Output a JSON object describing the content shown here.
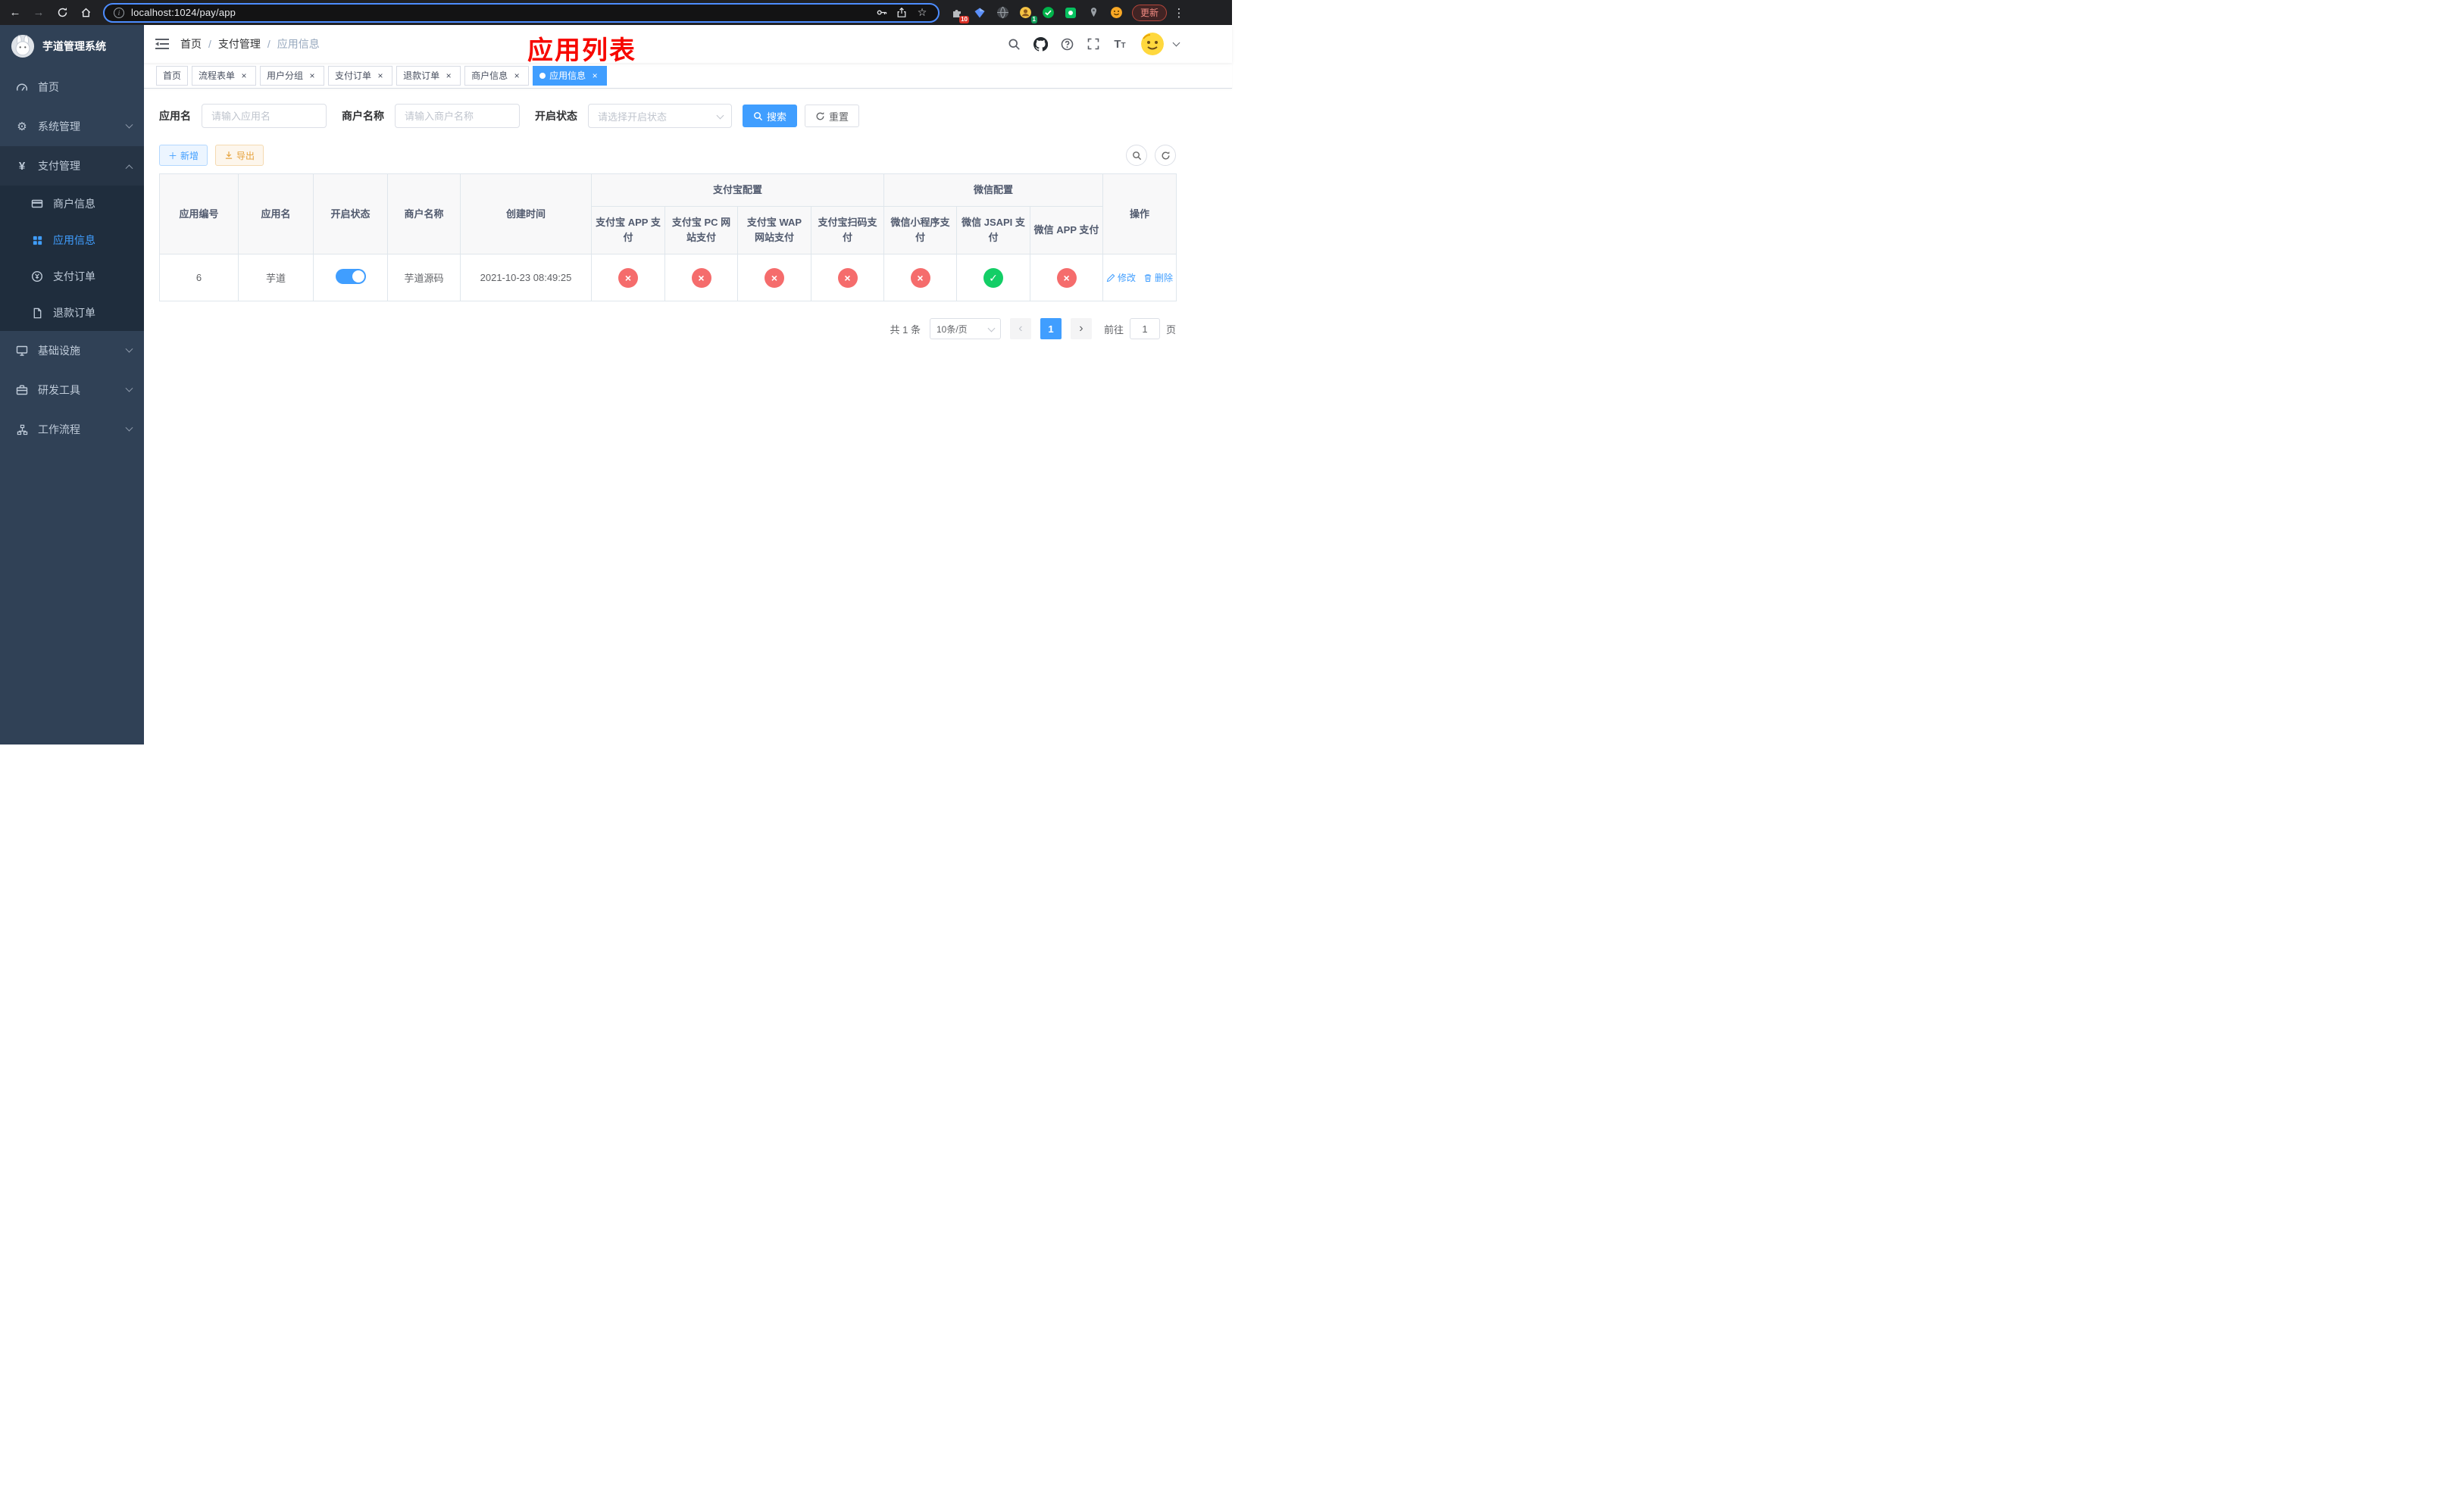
{
  "browser": {
    "url": "localhost:1024/pay/app",
    "update_label": "更新",
    "ext_badge_puzzle": "10",
    "ext_badge_avatar": "1"
  },
  "sidebar": {
    "title": "芋道管理系统",
    "menu": {
      "home": "首页",
      "system": "系统管理",
      "payment": "支付管理",
      "merchant_info": "商户信息",
      "app_info": "应用信息",
      "pay_order": "支付订单",
      "refund_order": "退款订单",
      "infra": "基础设施",
      "dev_tools": "研发工具",
      "workflow": "工作流程"
    }
  },
  "navbar": {
    "breadcrumb": {
      "home": "首页",
      "section": "支付管理",
      "current": "应用信息"
    },
    "annotation": "应用列表"
  },
  "tabs": [
    {
      "label": "首页"
    },
    {
      "label": "流程表单"
    },
    {
      "label": "用户分组"
    },
    {
      "label": "支付订单"
    },
    {
      "label": "退款订单"
    },
    {
      "label": "商户信息"
    },
    {
      "label": "应用信息"
    }
  ],
  "filter": {
    "app_name_label": "应用名",
    "app_name_placeholder": "请输入应用名",
    "merchant_label": "商户名称",
    "merchant_placeholder": "请输入商户名称",
    "status_label": "开启状态",
    "status_placeholder": "请选择开启状态",
    "search_label": "搜索",
    "reset_label": "重置"
  },
  "toolbar": {
    "add_label": "新增",
    "export_label": "导出"
  },
  "table": {
    "headers": {
      "app_id": "应用编号",
      "app_name": "应用名",
      "status": "开启状态",
      "merchant_name": "商户名称",
      "create_time": "创建时间",
      "alipay_group": "支付宝配置",
      "wechat_group": "微信配置",
      "alipay_app": "支付宝 APP 支付",
      "alipay_pc": "支付宝 PC 网站支付",
      "alipay_wap": "支付宝 WAP 网站支付",
      "alipay_qr": "支付宝扫码支付",
      "wx_lite": "微信小程序支付",
      "wx_jsapi": "微信 JSAPI 支付",
      "wx_app": "微信 APP 支付",
      "actions": "操作"
    },
    "rows": [
      {
        "app_id": "6",
        "app_name": "芋道",
        "enabled": true,
        "merchant_name": "芋道源码",
        "create_time": "2021-10-23 08:49:25",
        "alipay_app": false,
        "alipay_pc": false,
        "alipay_wap": false,
        "alipay_qr": false,
        "wx_lite": false,
        "wx_jsapi": true,
        "wx_app": false,
        "edit_label": "修改",
        "delete_label": "删除"
      }
    ]
  },
  "pagination": {
    "total_label": "共 1 条",
    "page_size_label": "10条/页",
    "current_page": "1",
    "goto_label": "前往",
    "goto_value": "1",
    "page_unit": "页"
  },
  "colors": {
    "primary": "#409eff",
    "success": "#13ce66",
    "danger": "#f56c6c",
    "sidebar_bg": "#304156",
    "submenu_bg": "#1f2d3d",
    "annotation": "#f70800"
  }
}
